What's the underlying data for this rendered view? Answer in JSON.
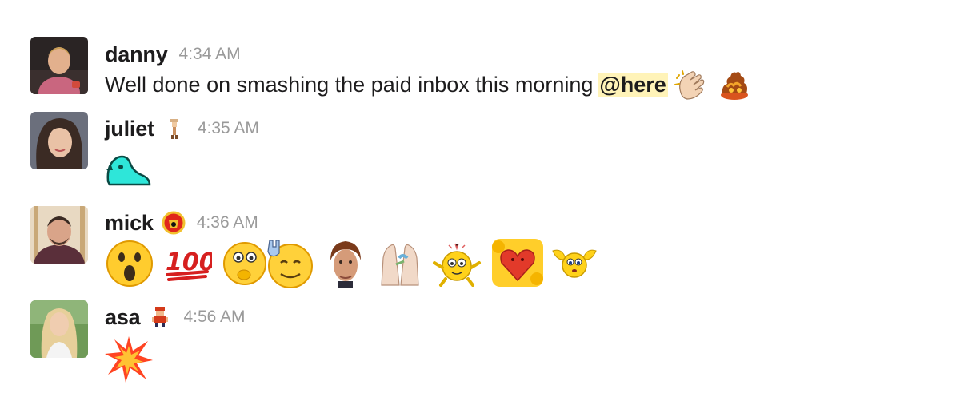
{
  "messages": [
    {
      "author": "danny",
      "time": "4:34 AM",
      "text": "Well done on smashing the paid inbox this morning",
      "mention": "@here",
      "status_icon": null,
      "reactions": [
        "clapping-hands",
        "fire-cake"
      ]
    },
    {
      "author": "juliet",
      "time": "4:35 AM",
      "status_icon": "pixel-figure-icon",
      "reactions": [
        "parrot"
      ]
    },
    {
      "author": "mick",
      "time": "4:36 AM",
      "status_icon": "manchester-united-crest-icon",
      "reactions": [
        "surprised-face",
        "hundred-points",
        "thinking-face",
        "rock-on-face",
        "rick-astley-face",
        "praying-hands",
        "cheering-smiley",
        "heart-smiley",
        "flying-smiley"
      ]
    },
    {
      "author": "asa",
      "time": "4:56 AM",
      "status_icon": "pixel-character-icon",
      "reactions": [
        "collision"
      ]
    }
  ],
  "colors": {
    "mention_bg": "#fff3b8",
    "time": "#9a9a9a",
    "text": "#1d1c1d"
  }
}
